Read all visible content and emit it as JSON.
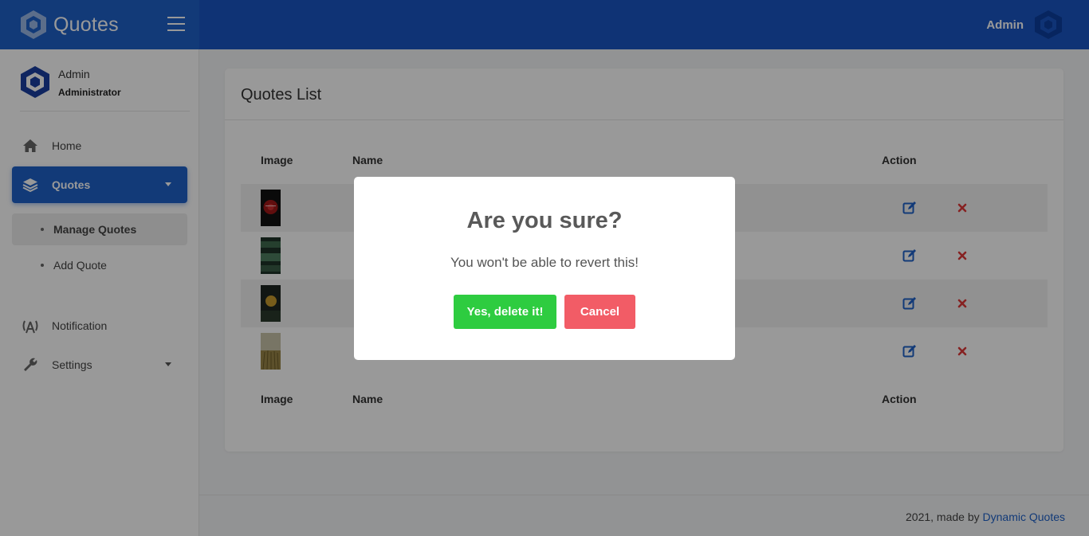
{
  "brand": {
    "name": "Quotes",
    "logo_icon": "hexagon-logo-icon",
    "menu_icon": "hamburger-icon"
  },
  "topbar": {
    "user_name": "Admin",
    "avatar_icon": "hexagon-avatar-icon"
  },
  "sidebar": {
    "user": {
      "name": "Admin",
      "role": "Administrator"
    },
    "items": [
      {
        "label": "Home",
        "icon": "home-icon"
      },
      {
        "label": "Quotes",
        "icon": "layers-icon",
        "active": true
      },
      {
        "label": "Notification",
        "icon": "broadcast-icon"
      },
      {
        "label": "Settings",
        "icon": "wrench-icon"
      }
    ],
    "subitems": [
      {
        "label": "Manage Quotes",
        "current": true
      },
      {
        "label": "Add Quote"
      }
    ]
  },
  "card": {
    "title": "Quotes List",
    "columns": {
      "image": "Image",
      "name": "Name",
      "action": "Action"
    },
    "rows": [
      {
        "thumb_color": "#8b1a1a"
      },
      {
        "thumb_color": "#2f4a3a"
      },
      {
        "thumb_color": "#3a3520"
      },
      {
        "thumb_color": "#9a8a55"
      }
    ]
  },
  "footer": {
    "prefix": "2021, made by ",
    "link": "Dynamic Quotes"
  },
  "modal": {
    "title": "Are you sure?",
    "text": "You won't be able to revert this!",
    "confirm": "Yes, delete it!",
    "cancel": "Cancel"
  },
  "colors": {
    "primary": "#1e61c9",
    "confirm": "#2ecc40",
    "cancel": "#f25c66",
    "delete_icon": "#e03a3a"
  }
}
